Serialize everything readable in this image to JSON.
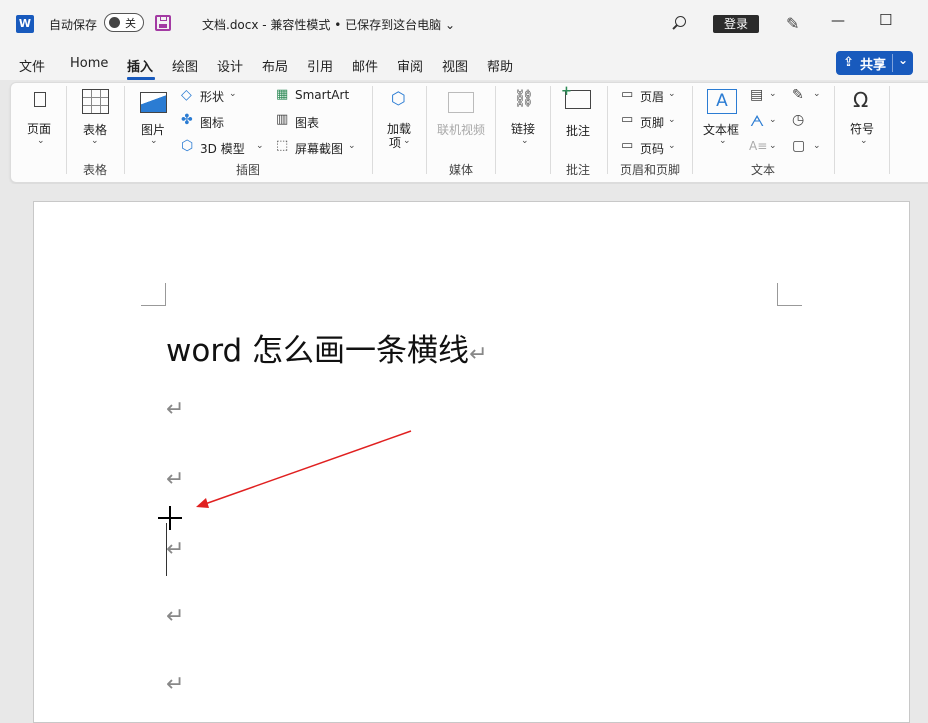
{
  "titlebar": {
    "app_logo": "W",
    "autosave_label": "自动保存",
    "autosave_state": "关",
    "doc_title": "文档.docx  -  兼容性模式 • 已保存到这台电脑  ⌄",
    "login_label": "登录"
  },
  "menu": {
    "items": [
      "文件",
      "Home",
      "插入",
      "绘图",
      "设计",
      "布局",
      "引用",
      "邮件",
      "审阅",
      "视图",
      "帮助"
    ],
    "active": "插入",
    "share_label": "共享"
  },
  "ribbon": {
    "pages": "页面",
    "table": "表格",
    "group_table": "表格",
    "picture": "图片",
    "shapes": "形状",
    "icons": "图标",
    "model3d": "3D 模型",
    "smartart": "SmartArt",
    "chart": "图表",
    "screenshot": "屏幕截图",
    "group_illustrations": "插图",
    "addins": "加载",
    "addins2": "项",
    "online_video": "联机视频",
    "group_media": "媒体",
    "link": "链接",
    "comment": "批注",
    "group_comment": "批注",
    "header": "页眉",
    "footer": "页脚",
    "page_number": "页码",
    "group_header_footer": "页眉和页脚",
    "textbox": "文本框",
    "group_text": "文本",
    "symbol": "符号",
    "omega": "Ω"
  },
  "document": {
    "heading": "word 怎么画一条横线",
    "para_mark": "↵"
  },
  "colors": {
    "accent": "#185abd",
    "arrow": "#e02020"
  }
}
